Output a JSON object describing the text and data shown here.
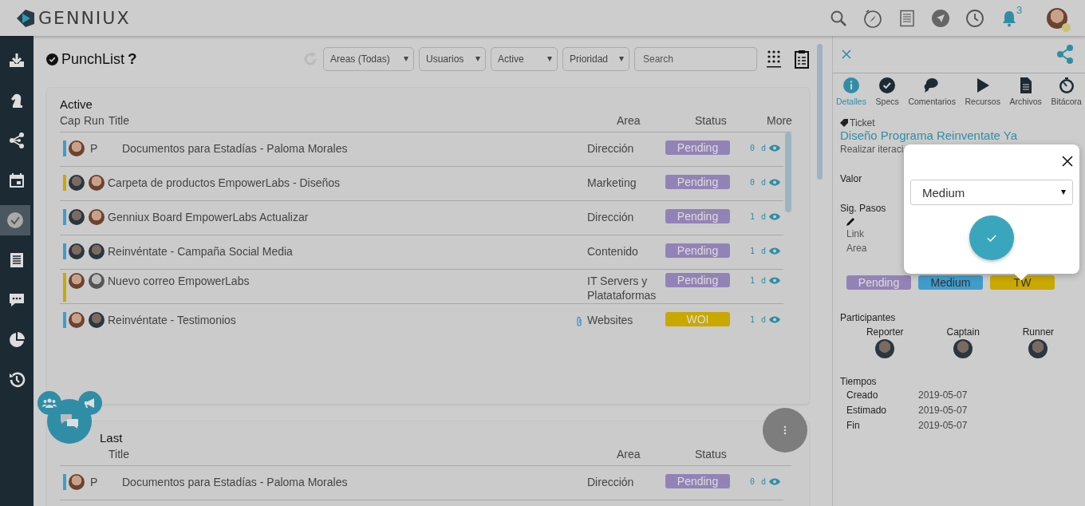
{
  "header": {
    "logo": "GENNIUX",
    "icons": [
      {
        "kind": "search"
      },
      {
        "kind": "compass"
      },
      {
        "kind": "document"
      },
      {
        "kind": "navigate"
      },
      {
        "kind": "clock"
      }
    ],
    "notifications": "3"
  },
  "sidebar": {
    "items": [
      {
        "kind": "download",
        "selected": false
      },
      {
        "kind": "knight",
        "selected": false
      },
      {
        "kind": "nodes",
        "selected": false
      },
      {
        "kind": "calendar",
        "selected": false
      },
      {
        "kind": "check",
        "selected": true
      },
      {
        "kind": "list",
        "selected": false
      },
      {
        "kind": "chat",
        "selected": false
      },
      {
        "kind": "pie",
        "selected": false
      },
      {
        "kind": "history",
        "selected": false
      }
    ]
  },
  "page": {
    "title": "PunchList",
    "help": "?",
    "filters": [
      {
        "label": "Areas (Todas)"
      },
      {
        "label": "Usuarios"
      },
      {
        "label": "Active"
      },
      {
        "label": "Prioridad"
      }
    ],
    "search": {
      "placeholder": "Search"
    }
  },
  "sections": [
    {
      "title": "Active",
      "columns": [
        {
          "kind": "cap",
          "label": "Cap"
        },
        {
          "kind": "run",
          "label": "Run"
        },
        {
          "kind": "title",
          "label": "Title"
        },
        {
          "kind": "area",
          "label": "Area"
        },
        {
          "kind": "status",
          "label": "Status"
        },
        {
          "kind": "more",
          "label": "More"
        }
      ],
      "rows": [
        {
          "color": "#3f9ccb",
          "avatars": [
            {
              "kind": "light"
            }
          ],
          "initial": "P",
          "title": "Documentos para Estadías - Paloma Morales",
          "area": "Dirección",
          "status": {
            "label": "Pending",
            "color": "#9283b6"
          },
          "age": "0 d",
          "attachment": false
        },
        {
          "color": "#c9a800",
          "avatars": [
            {
              "kind": "dark"
            },
            {
              "kind": "light"
            }
          ],
          "title": "Carpeta de productos EmpowerLabs - Diseños",
          "area": "Marketing",
          "status": {
            "label": "Pending",
            "color": "#9283b6"
          },
          "age": "0 d",
          "attachment": false
        },
        {
          "color": "#3f9ccb",
          "avatars": [
            {
              "kind": "dark"
            },
            {
              "kind": "light"
            }
          ],
          "title": "Genniux Board EmpowerLabs Actualizar",
          "area": "Dirección",
          "status": {
            "label": "Pending",
            "color": "#9283b6"
          },
          "age": "1 d",
          "attachment": false
        },
        {
          "color": "#3f9ccb",
          "avatars": [
            {
              "kind": "dark"
            },
            {
              "kind": "dark"
            }
          ],
          "title": "Reinvéntate - Campaña Social Media",
          "area": "Contenido",
          "status": {
            "label": "Pending",
            "color": "#9283b6"
          },
          "age": "1 d",
          "attachment": false
        },
        {
          "color": "#c9a800",
          "avatars": [
            {
              "kind": "light"
            },
            {
              "kind": "grey"
            }
          ],
          "title": "Nuevo correo EmpowerLabs",
          "area": "IT Servers y Platataformas",
          "status": {
            "label": "Pending",
            "color": "#9283b6"
          },
          "age": "1 d",
          "attachment": false
        },
        {
          "color": "#3f9ccb",
          "avatars": [
            {
              "kind": "light"
            },
            {
              "kind": "dark"
            }
          ],
          "title": "Reinvéntate - Testimonios",
          "area": "Websites",
          "status": {
            "label": "WOI",
            "color": "#c9a800"
          },
          "age": "1 d",
          "attachment": true
        }
      ]
    },
    {
      "title": "Last",
      "columns": [
        {
          "kind": "title",
          "label": "Title"
        },
        {
          "kind": "area",
          "label": "Area"
        },
        {
          "kind": "status",
          "label": "Status"
        }
      ],
      "rows": [
        {
          "color": "#3f9ccb",
          "avatars": [
            {
              "kind": "light"
            }
          ],
          "initial": "P",
          "title": "Documentos para Estadías - Paloma Morales",
          "area": "Dirección",
          "status": {
            "label": "Pending",
            "color": "#9283b6"
          },
          "age": "0 d",
          "attachment": false
        }
      ]
    }
  ],
  "panel": {
    "tabs": [
      {
        "kind": "info",
        "label": "Detalles",
        "selected": true
      },
      {
        "kind": "check",
        "label": "Specs",
        "selected": false
      },
      {
        "kind": "comments",
        "label": "Comentarios",
        "selected": false
      },
      {
        "kind": "play",
        "label": "Recursos",
        "selected": false
      },
      {
        "kind": "file",
        "label": "Archivos",
        "selected": false
      },
      {
        "kind": "timer",
        "label": "Bitácora",
        "selected": false
      }
    ],
    "ticket": {
      "label": "Ticket",
      "title": "Diseño Programa Reinventate Ya",
      "description": "Realizar iteraci"
    },
    "value_label": "Valor",
    "next_steps": {
      "label": "Sig. Pasos",
      "items": [
        "Link",
        "Area"
      ]
    },
    "tags": [
      {
        "label": "Pending",
        "color": "#9283b6"
      },
      {
        "label": "Medium",
        "color": "#3f9ccb"
      },
      {
        "label": "TW",
        "color": "#c9a800"
      }
    ],
    "participants": {
      "title": "Participantes",
      "roles": [
        "Reporter",
        "Captain",
        "Runner"
      ]
    },
    "times": {
      "title": "Tiempos",
      "rows": [
        {
          "label": "Creado",
          "value": "2019-05-07"
        },
        {
          "label": "Estimado",
          "value": "2019-05-07"
        },
        {
          "label": "Fin",
          "value": "2019-05-07"
        }
      ]
    },
    "popup": {
      "value": "Medium"
    }
  }
}
